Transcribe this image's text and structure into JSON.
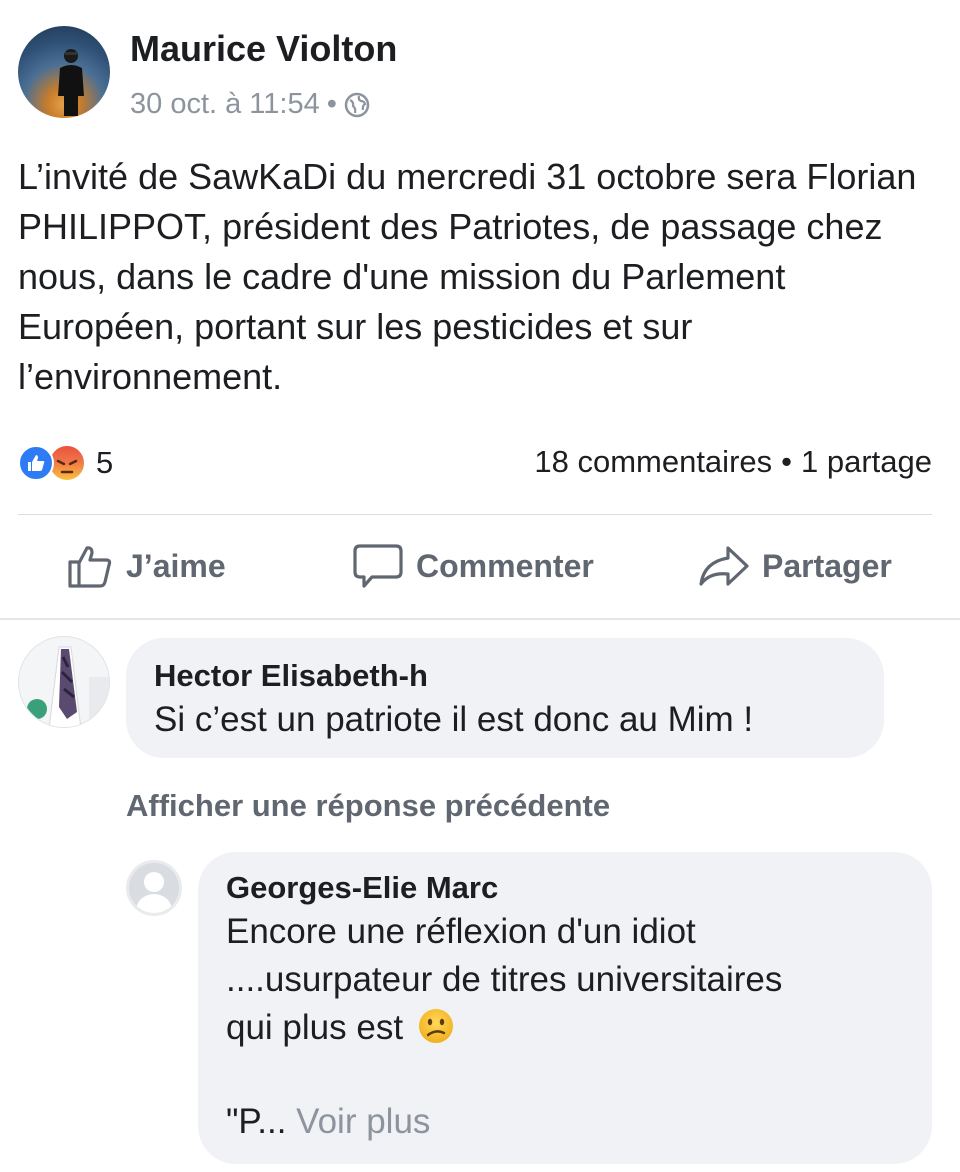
{
  "post": {
    "author": "Maurice Violton",
    "date": "30 oct. à 11:54",
    "separator": "•",
    "text": "L’invité de SawKaDi du mercredi 31 octobre sera Florian PHILIPPOT, président des Patriotes, de passage chez nous, dans le cadre d'une mission du Parlement Européen, portant sur les pesticides et sur l’environnement.",
    "reaction_count": "5",
    "comments_count": "18 commentaires",
    "stats_separator": "•",
    "shares_count": "1 partage"
  },
  "actions": {
    "like_label": "J’aime",
    "comment_label": "Commenter",
    "share_label": "Partager"
  },
  "comments": [
    {
      "author": "Hector Elisabeth-h",
      "text": "Si c’est un patriote il est donc au Mim !"
    }
  ],
  "previous_replies_label": "Afficher une réponse précédente",
  "reply": {
    "author": "Georges-Elie Marc",
    "line1": "Encore une réflexion d'un idiot",
    "line2": "....usurpateur de titres universitaires",
    "line3": "qui plus est",
    "truncated": "\"P...",
    "see_more": "Voir plus"
  },
  "colors": {
    "like_blue": "#2e7bf6",
    "secondary_text": "#606770",
    "meta_grey": "#8d949e",
    "bubble_bg": "#f0f2f5"
  }
}
